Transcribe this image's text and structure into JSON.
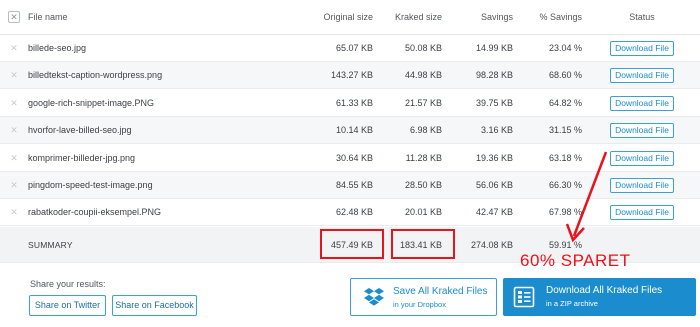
{
  "header": {
    "file_name": "File name",
    "original_size": "Original size",
    "kraked_size": "Kraked size",
    "savings": "Savings",
    "percent_savings": "% Savings",
    "status": "Status",
    "clear_icon_glyph": "✕"
  },
  "rows": [
    {
      "name": "billede-seo.jpg",
      "original": "65.07 KB",
      "kraked": "50.08 KB",
      "savings": "14.99 KB",
      "percent": "23.04 %",
      "status": "Download File"
    },
    {
      "name": "billedtekst-caption-wordpress.png",
      "original": "143.27 KB",
      "kraked": "44.98 KB",
      "savings": "98.28 KB",
      "percent": "68.60 %",
      "status": "Download File"
    },
    {
      "name": "google-rich-snippet-image.PNG",
      "original": "61.33 KB",
      "kraked": "21.57 KB",
      "savings": "39.75 KB",
      "percent": "64.82 %",
      "status": "Download File"
    },
    {
      "name": "hvorfor-lave-billed-seo.jpg",
      "original": "10.14 KB",
      "kraked": "6.98 KB",
      "savings": "3.16 KB",
      "percent": "31.15 %",
      "status": "Download File"
    },
    {
      "name": "komprimer-billeder-jpg.png",
      "original": "30.64 KB",
      "kraked": "11.28 KB",
      "savings": "19.36 KB",
      "percent": "63.18 %",
      "status": "Download File"
    },
    {
      "name": "pingdom-speed-test-image.png",
      "original": "84.55 KB",
      "kraked": "28.50 KB",
      "savings": "56.06 KB",
      "percent": "66.30 %",
      "status": "Download File"
    },
    {
      "name": "rabatkoder-coupii-eksempel.PNG",
      "original": "62.48 KB",
      "kraked": "20.01 KB",
      "savings": "42.47 KB",
      "percent": "67.98 %",
      "status": "Download File"
    }
  ],
  "row_remove_glyph": "✕",
  "summary": {
    "label": "SUMMARY",
    "original": "457.49 KB",
    "kraked": "183.41 KB",
    "savings": "274.08 KB",
    "percent": "59.91 %"
  },
  "share": {
    "label": "Share your results:",
    "twitter": "Share on Twitter",
    "facebook": "Share on Facebook"
  },
  "dropbox_button": {
    "title": "Save All Kraked Files",
    "subtitle": "in your Dropbox",
    "icon": "dropbox-icon"
  },
  "zip_button": {
    "title": "Download All Kraked Files",
    "subtitle": "in a ZIP archive",
    "icon": "zip-archive-icon"
  },
  "annotation": {
    "text": "60% SPARET",
    "color": "#e8141b"
  },
  "colors": {
    "accent": "#1b8ccd",
    "annotation_red": "#e8141b"
  }
}
